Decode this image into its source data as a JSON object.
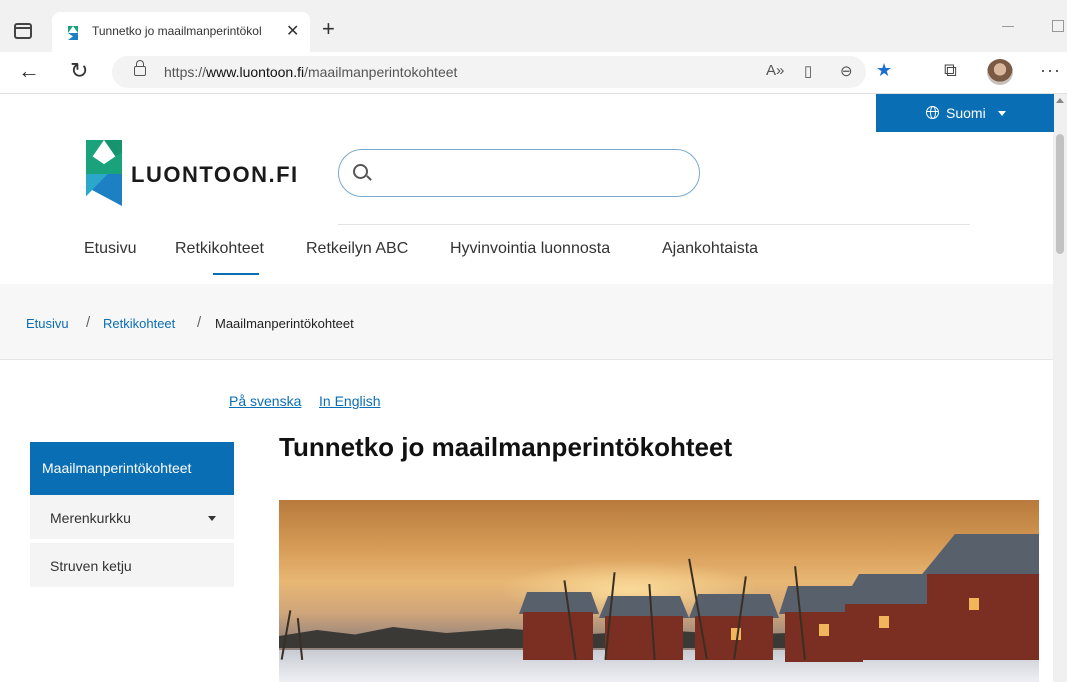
{
  "browser": {
    "tab_title": "Tunnetko jo maailmanperintökol",
    "url_prefix": "https://",
    "url_domain": "www.luontoon.fi",
    "url_path": "/maailmanperintokohteet"
  },
  "header": {
    "language_button": "Suomi",
    "site_name": "LUONTOON.FI",
    "search_placeholder": ""
  },
  "main_nav": [
    {
      "label": "Etusivu"
    },
    {
      "label": "Retkikohteet"
    },
    {
      "label": "Retkeilyn ABC"
    },
    {
      "label": "Hyvinvointia luonnosta"
    },
    {
      "label": "Ajankohtaista"
    }
  ],
  "breadcrumb": {
    "items": [
      "Etusivu",
      "Retkikohteet",
      "Maailmanperintökohteet"
    ],
    "separator": "/"
  },
  "alt_languages": [
    "På svenska",
    "In English"
  ],
  "side_nav": {
    "active": "Maailmanperintökohteet",
    "items": [
      {
        "label": "Merenkurkku",
        "expandable": true
      },
      {
        "label": "Struven ketju",
        "expandable": false
      }
    ]
  },
  "page": {
    "title": "Tunnetko jo maailmanperintökohteet"
  },
  "colors": {
    "brand_blue": "#0a6eb4",
    "brand_green": "#1aa37a"
  }
}
